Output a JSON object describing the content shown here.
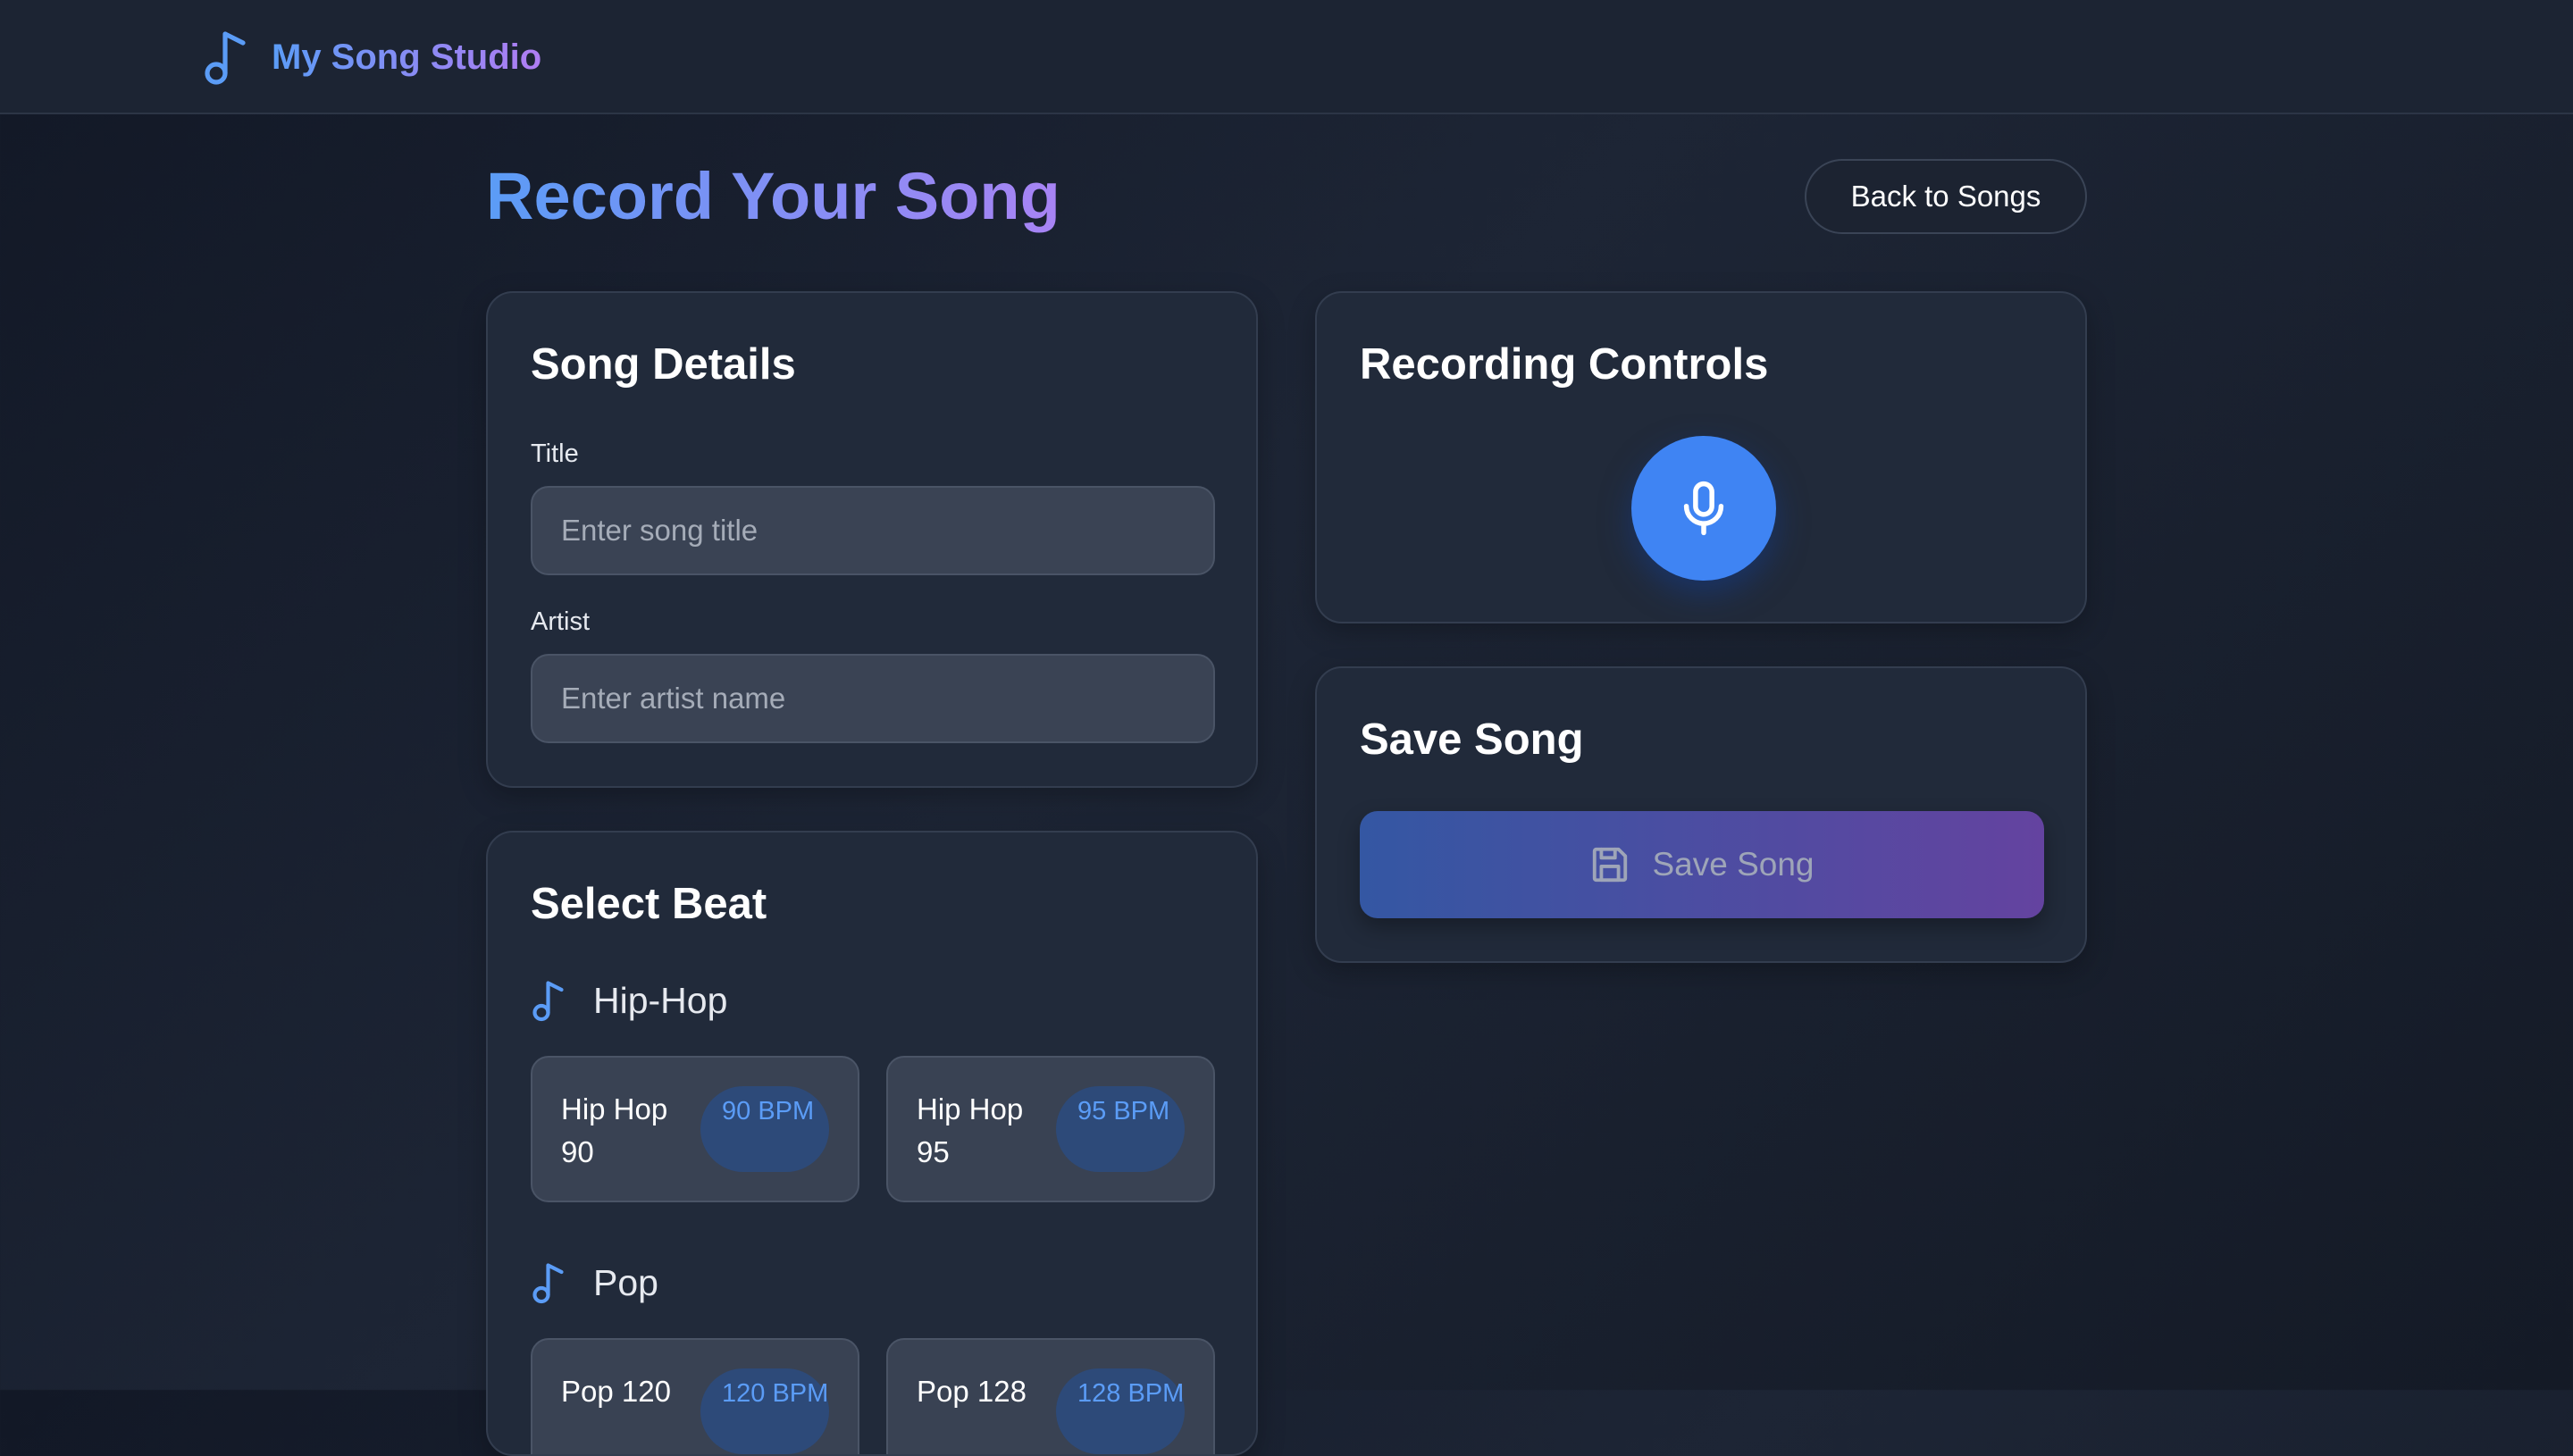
{
  "header": {
    "app_name": "My Song Studio",
    "logo_icon": "music-note-icon"
  },
  "page": {
    "title": "Record Your Song",
    "back_button": "Back to Songs"
  },
  "song_details": {
    "heading": "Song Details",
    "title_label": "Title",
    "title_placeholder": "Enter song title",
    "title_value": "",
    "artist_label": "Artist",
    "artist_placeholder": "Enter artist name",
    "artist_value": ""
  },
  "select_beat": {
    "heading": "Select Beat",
    "genres": [
      {
        "name": "Hip-Hop",
        "icon": "music-note-icon",
        "beats": [
          {
            "name": "Hip Hop 90",
            "bpm": "90 BPM"
          },
          {
            "name": "Hip Hop 95",
            "bpm": "95 BPM"
          }
        ]
      },
      {
        "name": "Pop",
        "icon": "music-note-icon",
        "beats": [
          {
            "name": "Pop 120",
            "bpm": "120 BPM"
          },
          {
            "name": "Pop 128",
            "bpm": "128 BPM"
          }
        ]
      }
    ]
  },
  "recording_controls": {
    "heading": "Recording Controls",
    "record_icon": "microphone-icon"
  },
  "save_song": {
    "heading": "Save Song",
    "button_label": "Save Song",
    "button_icon": "floppy-disk-icon"
  },
  "colors": {
    "accent_blue": "#3f84f3",
    "accent_purple": "#a883f4",
    "card_bg": "#212a3a",
    "page_bg": "#161d2a"
  }
}
